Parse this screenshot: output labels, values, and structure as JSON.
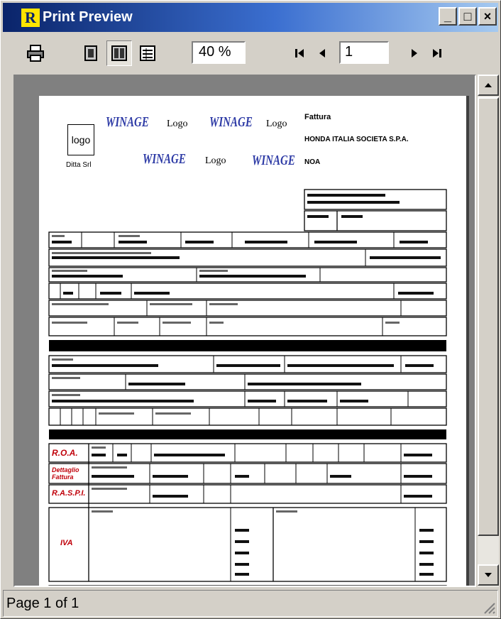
{
  "window": {
    "title": "Print Preview",
    "icon_letter": "R"
  },
  "titlebar_buttons": {
    "minimize": "_",
    "maximize": "□",
    "close": "×"
  },
  "toolbar": {
    "zoom_value": "40 %",
    "page_value": "1",
    "icons": [
      "printer-icon",
      "one-page-icon",
      "two-page-icon",
      "page-width-icon",
      "first-page-icon",
      "previous-page-icon",
      "next-page-icon",
      "last-page-icon"
    ]
  },
  "paper": {
    "logo_box": "logo",
    "logo_caption": "Ditta Srl",
    "logos": [
      "WINAGE",
      "Logo",
      "WINAGE",
      "Logo",
      "WINAGE",
      "Logo",
      "WINAGE"
    ],
    "company_lines": [
      "Fattura",
      "HONDA ITALIA SOCIETA S.P.A.",
      "NOA"
    ],
    "section_labels": [
      "R.O.A.",
      "Dettaglio Fattura",
      "R.A.S.P.I.",
      "IVA"
    ]
  },
  "statusbar": {
    "text": "Page 1 of 1"
  }
}
